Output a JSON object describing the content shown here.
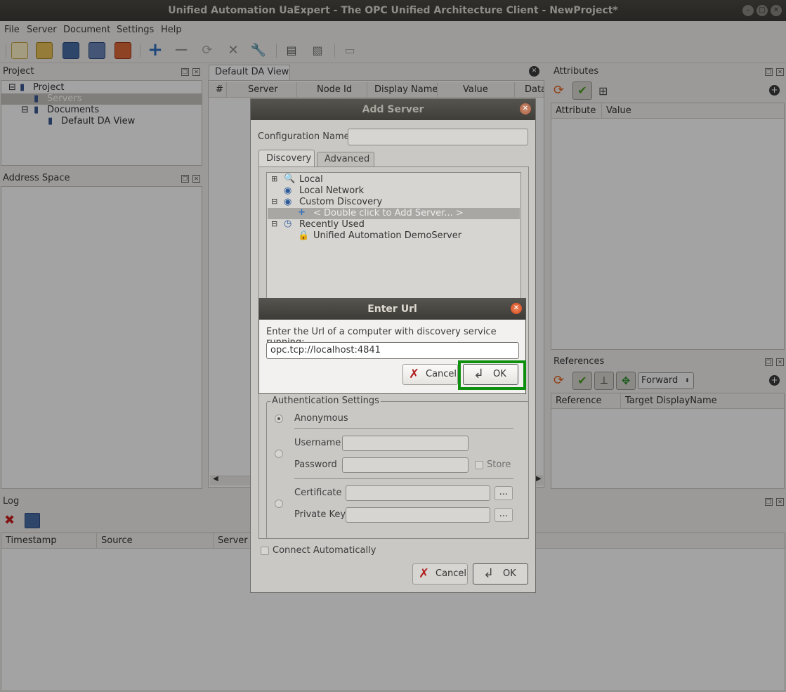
{
  "window": {
    "title": "Unified Automation UaExpert - The OPC Unified Architecture Client - NewProject*"
  },
  "menubar": [
    "File",
    "Server",
    "Document",
    "Settings",
    "Help"
  ],
  "project_panel": {
    "title": "Project",
    "tree": [
      "Project",
      "Servers",
      "Documents",
      "Default DA View"
    ]
  },
  "address_space_panel": {
    "title": "Address Space"
  },
  "document_tab": {
    "label": "Default DA View",
    "columns": [
      "#",
      "Server",
      "Node Id",
      "Display Name",
      "Value",
      "Data"
    ]
  },
  "attributes_panel": {
    "title": "Attributes",
    "columns": [
      "Attribute",
      "Value"
    ]
  },
  "references_panel": {
    "title": "References",
    "direction": "Forward",
    "columns": [
      "Reference",
      "Target DisplayName"
    ]
  },
  "log_panel": {
    "title": "Log",
    "columns": [
      "Timestamp",
      "Source",
      "Server"
    ]
  },
  "add_server_dialog": {
    "title": "Add Server",
    "config_name_label": "Configuration Name",
    "config_name_value": "",
    "tabs": [
      "Discovery",
      "Advanced"
    ],
    "discovery_tree": {
      "local": "Local",
      "local_network": "Local Network",
      "custom_discovery": "Custom Discovery",
      "add_server_placeholder": "< Double click to Add Server... >",
      "recently_used": "Recently Used",
      "demo_server": "Unified Automation DemoServer"
    },
    "auth": {
      "group_label": "Authentication Settings",
      "anonymous": "Anonymous",
      "username": "Username",
      "password": "Password",
      "store": "Store",
      "certificate": "Certificate",
      "private_key": "Private Key",
      "browse": "..."
    },
    "connect_automatically": "Connect Automatically",
    "cancel": "Cancel",
    "ok": "OK"
  },
  "enter_url_dialog": {
    "title": "Enter Url",
    "prompt": "Enter the Url of a computer with discovery service running:",
    "url_value": "opc.tcp://localhost:4841",
    "cancel": "Cancel",
    "ok": "OK"
  },
  "colors": {
    "highlight_border": "#0f8f0f",
    "title_bar": "#3c3b37",
    "selection": "#c9c6bf"
  }
}
